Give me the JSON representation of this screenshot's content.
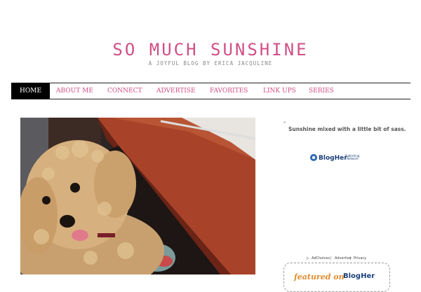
{
  "site": {
    "title": "SO MUCH SUNSHINE",
    "tagline": "A JOYFUL BLOG BY ERICA JACQULINE"
  },
  "nav": {
    "items": [
      "HOME",
      "ABOUT ME",
      "CONNECT",
      "ADVERTISE",
      "FAVORITES",
      "LINK UPS",
      "SERIES"
    ],
    "active": "HOME",
    "accent": "#d14f86"
  },
  "sidebar": {
    "tagline": "Sunshine mixed with a little bit of sass.",
    "badge": {
      "blogher": "BlogHer",
      "sub": "Publishing Network"
    },
    "ad_links": [
      "AdChoices",
      "Advertise",
      "Privacy"
    ],
    "featured": {
      "text": "featured on",
      "logo": "BlogHer"
    }
  },
  "post": {
    "image": "dog-photo"
  }
}
